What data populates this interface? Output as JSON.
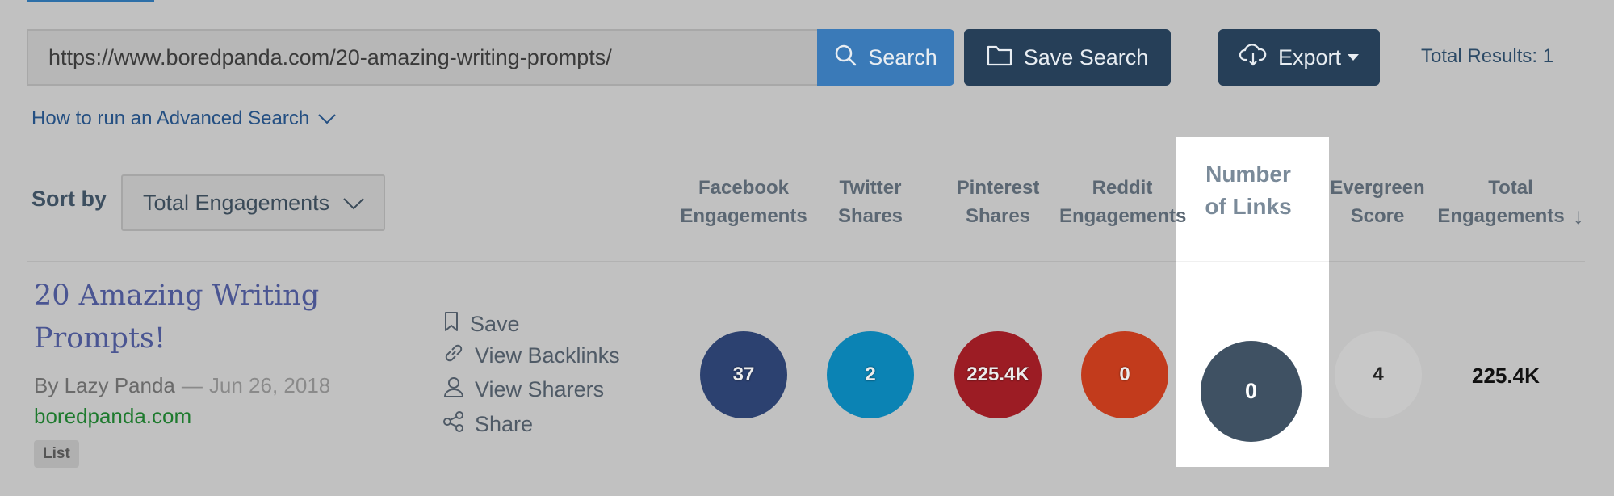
{
  "search": {
    "value": "https://www.boredpanda.com/20-amazing-writing-prompts/",
    "button_label": "Search",
    "save_label": "Save Search",
    "export_label": "Export",
    "total_results": "Total Results: 1"
  },
  "advanced_link": "How to run an Advanced Search",
  "sort": {
    "label": "Sort by",
    "selected": "Total Engagements"
  },
  "columns": [
    {
      "line1": "Facebook",
      "line2": "Engagements"
    },
    {
      "line1": "Twitter",
      "line2": "Shares"
    },
    {
      "line1": "Pinterest",
      "line2": "Shares"
    },
    {
      "line1": "Reddit",
      "line2": "Engagements"
    },
    {
      "line1": "Number",
      "line2": "of Links"
    },
    {
      "line1": "Evergreen",
      "line2": "Score"
    },
    {
      "line1": "Total",
      "line2": "Engagements",
      "sort_arrow": "↓"
    }
  ],
  "result": {
    "title": "20 Amazing Writing Prompts!",
    "author": "By Lazy Panda",
    "separator": "—",
    "date": "Jun 26, 2018",
    "domain": "boredpanda.com",
    "tag": "List",
    "actions": {
      "save": "Save",
      "backlinks": "View Backlinks",
      "sharers": "View Sharers",
      "share": "Share"
    },
    "metrics": {
      "facebook": "37",
      "twitter": "2",
      "pinterest": "225.4K",
      "reddit": "0",
      "links": "0",
      "evergreen": "4",
      "total": "225.4K"
    }
  },
  "colors": {
    "facebook": "#2c4170",
    "twitter": "#0b83b4",
    "pinterest": "#9c1c24",
    "reddit": "#c23b1c",
    "links": "#3f5163",
    "evergreen": "#c8c8c8",
    "primary_button": "#3a7ab8",
    "dark_button": "#263f58"
  }
}
